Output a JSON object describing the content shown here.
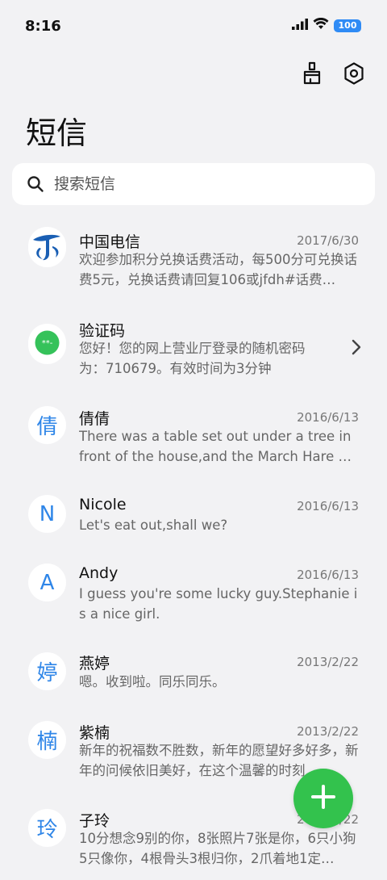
{
  "status": {
    "time": "8:16",
    "battery": "100"
  },
  "header": {
    "title": "短信"
  },
  "search": {
    "placeholder": "搜索短信"
  },
  "messages": [
    {
      "avatar": "",
      "avatar_icon": "telecom-logo-icon",
      "name": "中国电信",
      "date": "2017/6/30",
      "preview": "欢迎参加积分兑换话费活动，每500分可兑换话费5元，兑换话费请回复106或jfdh#话费…"
    },
    {
      "avatar": "",
      "avatar_icon": "message-bubble-icon",
      "name": "验证码",
      "date": "",
      "preview": "您好！您的网上营业厅登录的随机密码为：710679。有效时间为3分钟"
    },
    {
      "avatar": "倩",
      "name": "倩倩",
      "date": "2016/6/13",
      "preview": "There was a table set out under a tree in front of the house,and the March Hare an…"
    },
    {
      "avatar": "N",
      "name": "Nicole",
      "date": "2016/6/13",
      "preview": "Let's eat out,shall we?"
    },
    {
      "avatar": "A",
      "name": "Andy",
      "date": "2016/6/13",
      "preview": "I guess you're some lucky guy.Stephanie is a nice girl."
    },
    {
      "avatar": "婷",
      "name": "燕婷",
      "date": "2013/2/22",
      "preview": "嗯。收到啦。同乐同乐。"
    },
    {
      "avatar": "楠",
      "name": "紫楠",
      "date": "2013/2/22",
      "preview": "新年的祝福数不胜数，新年的愿望好多好多，新年的问候依旧美好，在这个温馨的时刻…"
    },
    {
      "avatar": "玲",
      "name": "子玲",
      "date": "2013/2/22",
      "preview": "10分想念9别的你，8张照片7张是你，6只小狗5只像你，4根骨头3根归你，2爪着地1定…"
    }
  ],
  "colors": {
    "accent": "#2f86e8",
    "fab": "#33c24d",
    "background": "#f2f2f4"
  }
}
